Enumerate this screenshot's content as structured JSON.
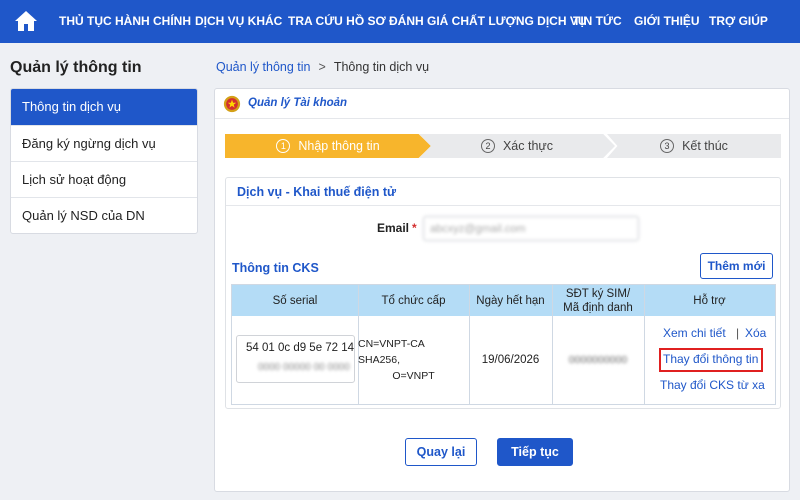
{
  "nav": {
    "items": [
      "THỦ TỤC HÀNH CHÍNH",
      "DỊCH VỤ KHÁC",
      "TRA CỨU HỒ SƠ",
      "ĐÁNH GIÁ CHẤT LƯỢNG DỊCH VỤ",
      "TIN TỨC",
      "GIỚI THIỆU",
      "TRỢ GIÚP"
    ],
    "color": "#1f57c9"
  },
  "sidebar": {
    "title": "Quản lý thông tin",
    "items": [
      "Thông tin dịch vụ",
      "Đăng ký ngừng dịch vụ",
      "Lịch sử hoạt động",
      "Quản lý NSD của DN"
    ],
    "active_index": 0
  },
  "breadcrumb": {
    "link": "Quản lý thông tin",
    "separator": ">",
    "current": "Thông tin dịch vụ"
  },
  "panel": {
    "title": "Quản lý Tài khoản"
  },
  "steps": [
    {
      "num": "1",
      "label": "Nhập thông tin",
      "state": "active"
    },
    {
      "num": "2",
      "label": "Xác thực",
      "state": "pending"
    },
    {
      "num": "3",
      "label": "Kết thúc",
      "state": "pending"
    }
  ],
  "form": {
    "section_title": "Dịch vụ - Khai thuế điện tử",
    "email_label": "Email",
    "required_mark": "*",
    "email_value": "abcxyz@gmail.com"
  },
  "cks": {
    "title": "Thông tin CKS",
    "add_button": "Thêm mới",
    "columns": [
      "Số serial",
      "Tổ chức cấp",
      "Ngày hết hạn",
      "SĐT ký SIM/",
      "Mã định danh",
      "Hỗ trợ"
    ],
    "row": {
      "serial_line1": "54 01 0c d9 5e 72 14",
      "serial_line2": "0000 00000 00 0000",
      "issuer_line1": "CN=VNPT-CA SHA256,",
      "issuer_line2": "O=VNPT",
      "expiry": "19/06/2026",
      "phone": "0000000000"
    },
    "support": {
      "view_details": "Xem chi tiết",
      "separator": "|",
      "delete": "Xóa",
      "change_info": "Thay đổi thông tin",
      "change_remote": "Thay đổi CKS từ xa"
    }
  },
  "actions": {
    "back": "Quay lại",
    "next": "Tiếp tục"
  },
  "colors": {
    "primary": "#1f57c9",
    "step_active": "#f7b52c",
    "table_header": "#b4dcf6",
    "highlight": "#e02020"
  }
}
